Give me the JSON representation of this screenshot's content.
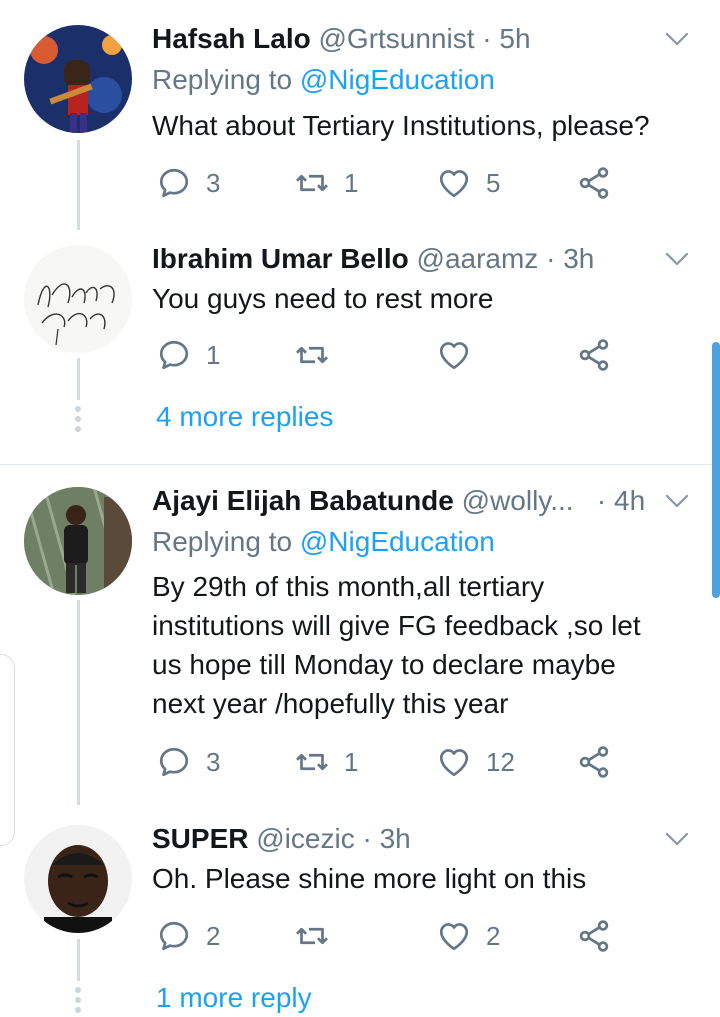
{
  "tweets": [
    {
      "name": "Hafsah Lalo",
      "handle": "@Grtsunnist",
      "sep": " · ",
      "time": "5h",
      "replying_prefix": "Replying to ",
      "replying_to": "@NigEducation",
      "text": "What about Tertiary Institutions, please?",
      "replies": "3",
      "retweets": "1",
      "likes": "5"
    },
    {
      "name": "Ibrahim Umar Bello",
      "handle": "@aaramz",
      "sep": " · ",
      "time": "3h",
      "text": "You guys need to rest more",
      "replies": "1",
      "retweets": "",
      "likes": "",
      "more_replies": "4 more replies",
      "avatar_signature": "Ibrahim Aaramz"
    },
    {
      "name": "Ajayi Elijah Babatunde",
      "handle": "@wolly...",
      "sep": " · ",
      "time": "4h",
      "replying_prefix": "Replying to ",
      "replying_to": "@NigEducation",
      "text": "By 29th of this month,all tertiary institutions will give FG feedback ,so let us hope till Monday to declare maybe next year /hopefully this year",
      "replies": "3",
      "retweets": "1",
      "likes": "12"
    },
    {
      "name": "SUPER",
      "handle": "@icezic",
      "sep": " · ",
      "time": "3h",
      "text": "Oh. Please shine more light on this",
      "replies": "2",
      "retweets": "",
      "likes": "2",
      "more_replies": "1 more reply"
    }
  ],
  "icons": {
    "reply": "reply-icon",
    "retweet": "retweet-icon",
    "like": "heart-icon",
    "share": "share-icon",
    "menu": "chevron-down-icon"
  },
  "colors": {
    "accent": "#1da1f2",
    "muted": "#657786",
    "text": "#14171a",
    "scrollbar": "#4aa3df"
  }
}
